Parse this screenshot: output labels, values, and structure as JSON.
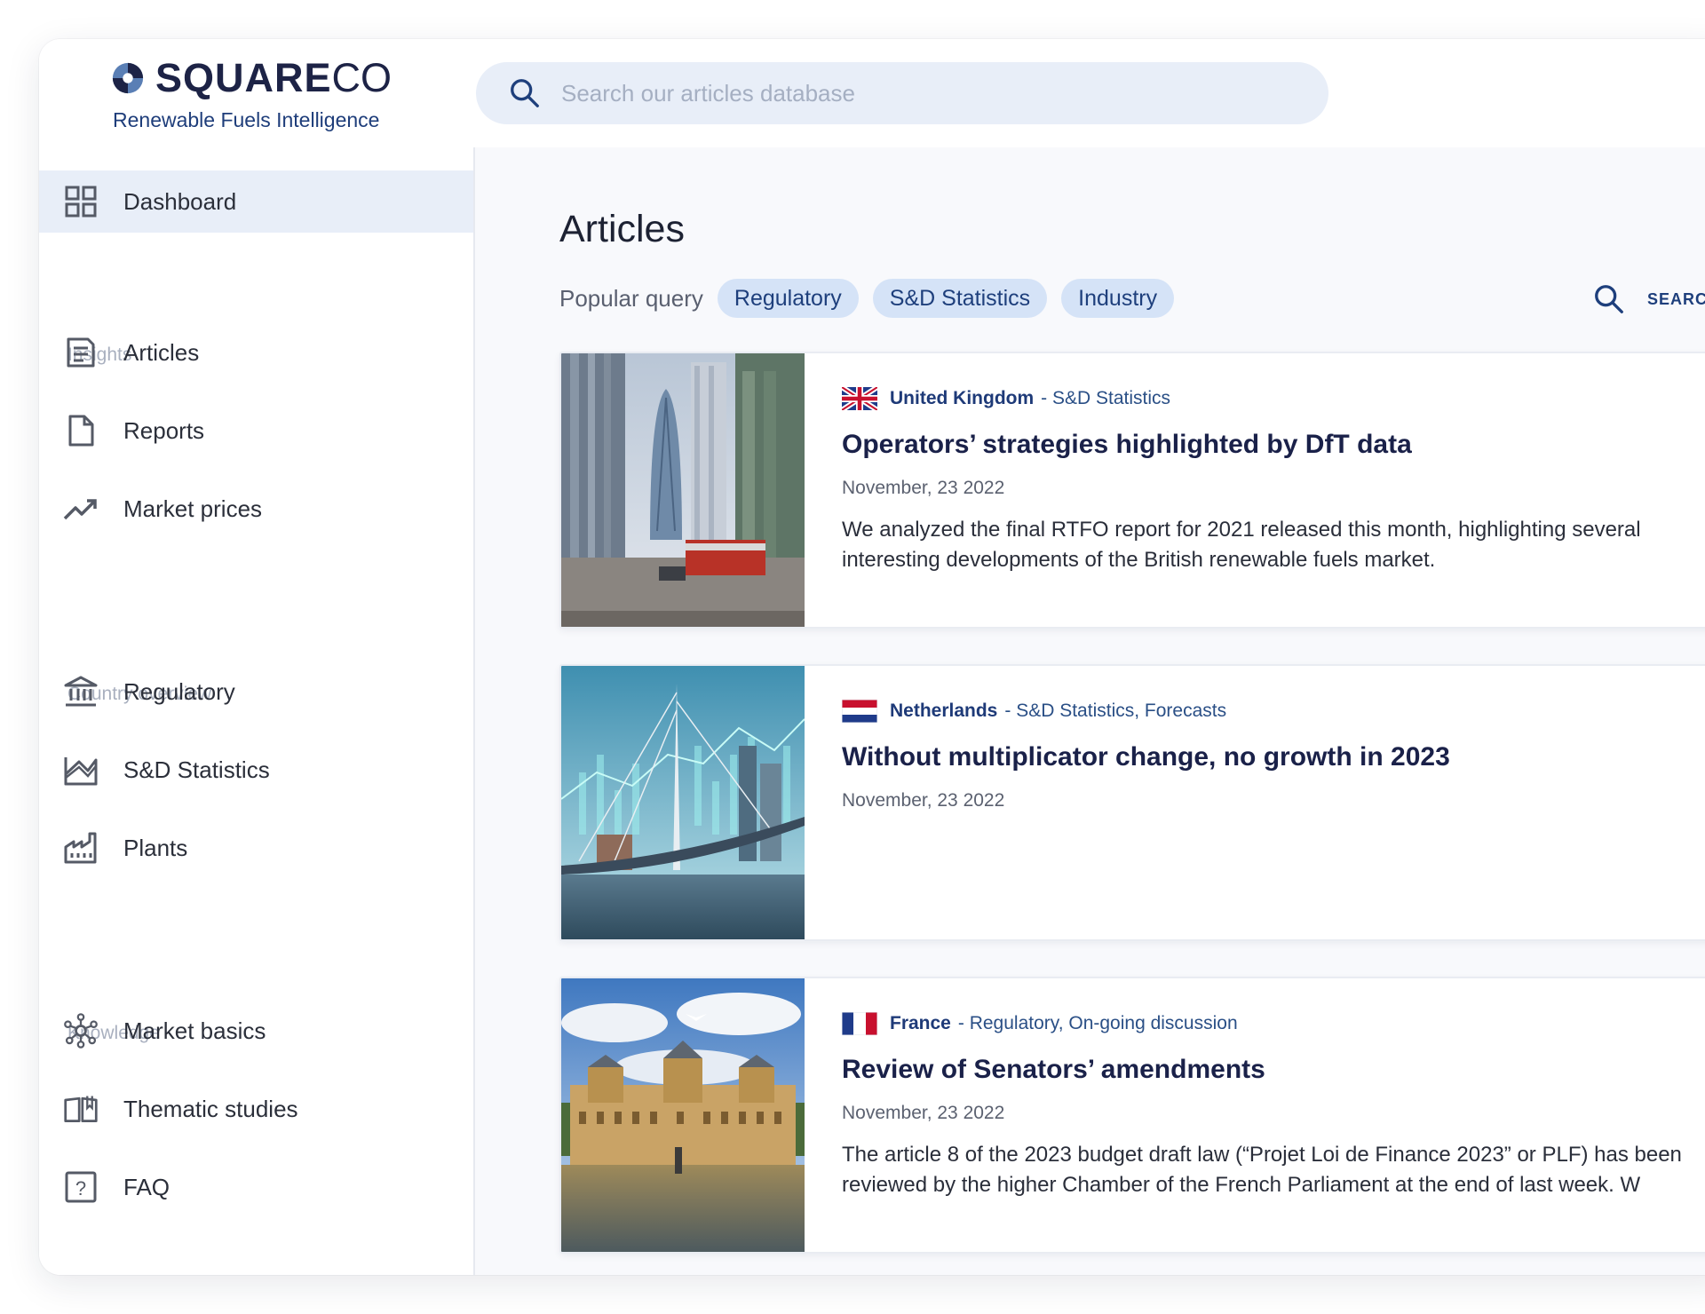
{
  "brand": {
    "name_bold": "SQUARE",
    "name_light": "CO",
    "tagline": "Renewable Fuels Intelligence"
  },
  "search": {
    "placeholder": "Search our articles database"
  },
  "sidebar": {
    "dashboard": "Dashboard",
    "sections": {
      "insights": "Insights",
      "country": "Country overview",
      "knowledge": "Knowledge"
    },
    "items": {
      "articles": "Articles",
      "reports": "Reports",
      "market_prices": "Market prices",
      "regulatory": "Regulatory",
      "sd_statistics": "S&D Statistics",
      "plants": "Plants",
      "market_basics": "Market basics",
      "thematic_studies": "Thematic studies",
      "faq": "FAQ"
    }
  },
  "main": {
    "title": "Articles",
    "popular_label": "Popular query",
    "chips": [
      "Regulatory",
      "S&D Statistics",
      "Industry"
    ],
    "search_label": "SEARCH"
  },
  "articles": [
    {
      "country": "United Kingdom",
      "tags": "- S&D Statistics",
      "title": "Operators’ strategies highlighted by DfT data",
      "date": "November, 23 2022",
      "excerpt_1": "We analyzed the final RTFO report for 2021 released this month, highlighting several",
      "excerpt_2": "interesting developments of the British renewable fuels market."
    },
    {
      "country": "Netherlands",
      "tags": "- S&D Statistics, Forecasts",
      "title": "Without multiplicator change, no growth in 2023",
      "date": "November, 23 2022"
    },
    {
      "country": "France",
      "tags": "- Regulatory, On-going discussion",
      "title": "Review of Senators’ amendments",
      "date": "November, 23 2022",
      "excerpt_1": "The article 8 of the 2023 budget draft law (“Projet Loi de Finance 2023” or PLF) has been",
      "excerpt_2": "reviewed by the higher Chamber of the French Parliament at the end of last week. W"
    }
  ],
  "colors": {
    "brand_navy": "#1d2346",
    "accent_blue": "#1e3f7c",
    "chip_bg": "#d5e3f7",
    "active_bg": "#e8eef8"
  }
}
